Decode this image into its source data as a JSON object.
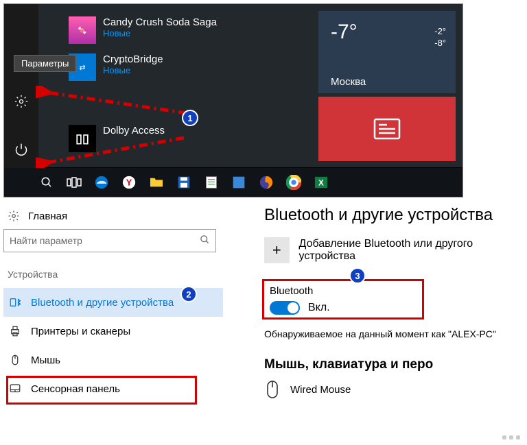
{
  "tooltip": "Параметры",
  "apps": {
    "candy": {
      "name": "Candy Crush Soda Saga",
      "sub": "Новые"
    },
    "crypto": {
      "name": "CryptoBridge",
      "sub": "Новые"
    },
    "dolby": {
      "name": "Dolby Access"
    }
  },
  "weather": {
    "temp": "-7°",
    "hi": "-2°",
    "lo": "-8°",
    "city": "Москва"
  },
  "settings": {
    "home": "Главная",
    "search_placeholder": "Найти параметр",
    "section": "Устройства",
    "nav": {
      "bluetooth": "Bluetooth и другие устройства",
      "printers": "Принтеры и сканеры",
      "mouse": "Мышь",
      "touch": "Сенсорная панель"
    }
  },
  "content": {
    "title": "Bluetooth и другие устройства",
    "add": "Добавление Bluetooth или другого устройства",
    "bt_label": "Bluetooth",
    "bt_state": "Вкл.",
    "discover": "Обнаруживаемое на данный момент как \"ALEX-PC\"",
    "section_mouse": "Мышь, клавиатура и перо",
    "mouse_device": "Wired Mouse"
  },
  "badges": {
    "b1": "1",
    "b2": "2",
    "b3": "3"
  }
}
